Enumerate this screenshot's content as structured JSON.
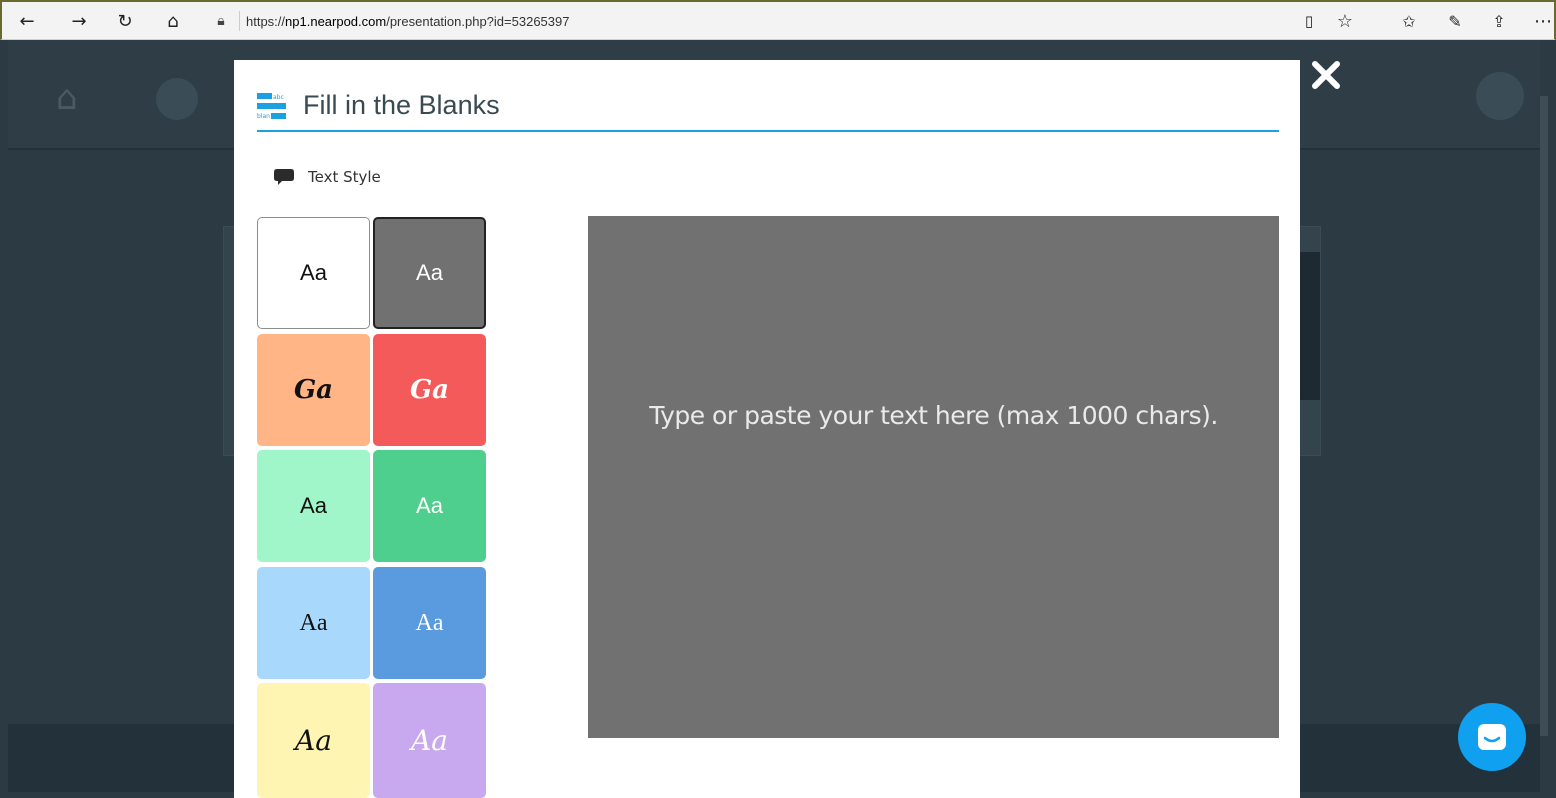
{
  "browser": {
    "url_prefix": "https://",
    "url_domain": "np1.nearpod.com",
    "url_path": "/presentation.php?id=53265397",
    "nav": {
      "back_icon": "back-arrow-icon",
      "forward_icon": "forward-arrow-icon",
      "refresh_icon": "refresh-icon",
      "home_icon": "home-icon"
    }
  },
  "modal": {
    "title": "Fill in the Blanks",
    "title_icon_text_top": "abc",
    "title_icon_text_bottom": "blan",
    "section_label": "Text Style",
    "editor_placeholder": "Type or paste your text here (max 1000 chars).",
    "swatches": [
      {
        "label": "Aa",
        "bg": "#ffffff",
        "color": "#111111",
        "selected": false
      },
      {
        "label": "Aa",
        "bg": "#717171",
        "color": "#ffffff",
        "selected": true
      },
      {
        "label": "Ga",
        "bg": "#ffb586",
        "color": "#111111",
        "selected": false
      },
      {
        "label": "Ga",
        "bg": "#f55a5a",
        "color": "#ffffff",
        "selected": false
      },
      {
        "label": "Aa",
        "bg": "#a0f5c9",
        "color": "#111111",
        "selected": false
      },
      {
        "label": "Aa",
        "bg": "#4fcf8d",
        "color": "#ffffff",
        "selected": false
      },
      {
        "label": "Aa",
        "bg": "#a8d8fb",
        "color": "#111111",
        "selected": false
      },
      {
        "label": "Aa",
        "bg": "#5a9be0",
        "color": "#ffffff",
        "selected": false
      },
      {
        "label": "Aa",
        "bg": "#fff5b3",
        "color": "#111111",
        "selected": false
      },
      {
        "label": "Aa",
        "bg": "#c8a9ef",
        "color": "#ffffff",
        "selected": false
      }
    ]
  },
  "colors": {
    "accent": "#1ba0e1",
    "chat_button": "#0fa0f0",
    "overlay": "#2b3a43"
  }
}
